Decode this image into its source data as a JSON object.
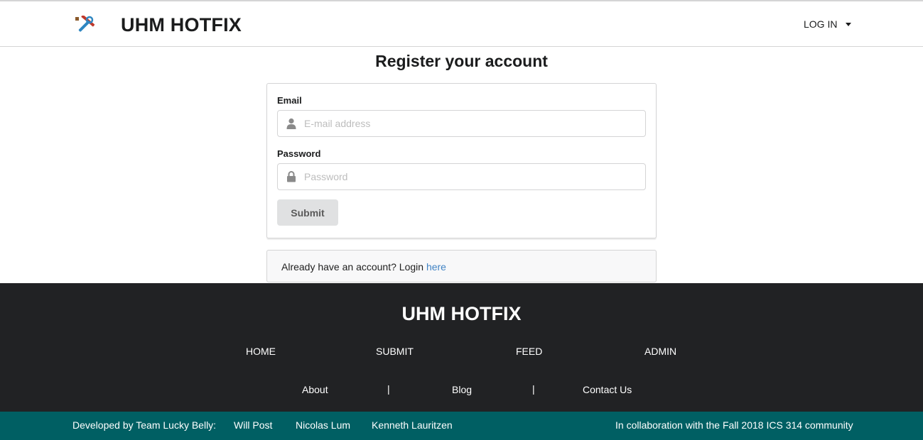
{
  "header": {
    "brand": "UHM HOTFIX",
    "logo_icon": "tools-icon",
    "login_label": "LOG IN"
  },
  "register": {
    "title": "Register your account",
    "email_label": "Email",
    "email_placeholder": "E-mail address",
    "email_value": "",
    "password_label": "Password",
    "password_placeholder": "Password",
    "password_value": "",
    "submit_label": "Submit"
  },
  "login_prompt": {
    "text": "Already have an account? Login ",
    "link": "here"
  },
  "footer": {
    "brand": "UHM HOTFIX",
    "nav": [
      "HOME",
      "SUBMIT",
      "FEED",
      "ADMIN"
    ],
    "links": [
      "About",
      "Blog",
      "Contact Us"
    ],
    "separator": "|"
  },
  "credits": {
    "developed_by": "Developed by Team Lucky Belly:",
    "members": [
      "Will Post",
      "Nicolas Lum",
      "Kenneth Lauritzen"
    ],
    "collaboration": "In collaboration with the Fall 2018 ICS 314 community"
  },
  "colors": {
    "footer_bg": "#212224",
    "bottom_bar_bg": "#005f63",
    "link": "#4183c4",
    "button_bg": "#e0e1e2"
  }
}
